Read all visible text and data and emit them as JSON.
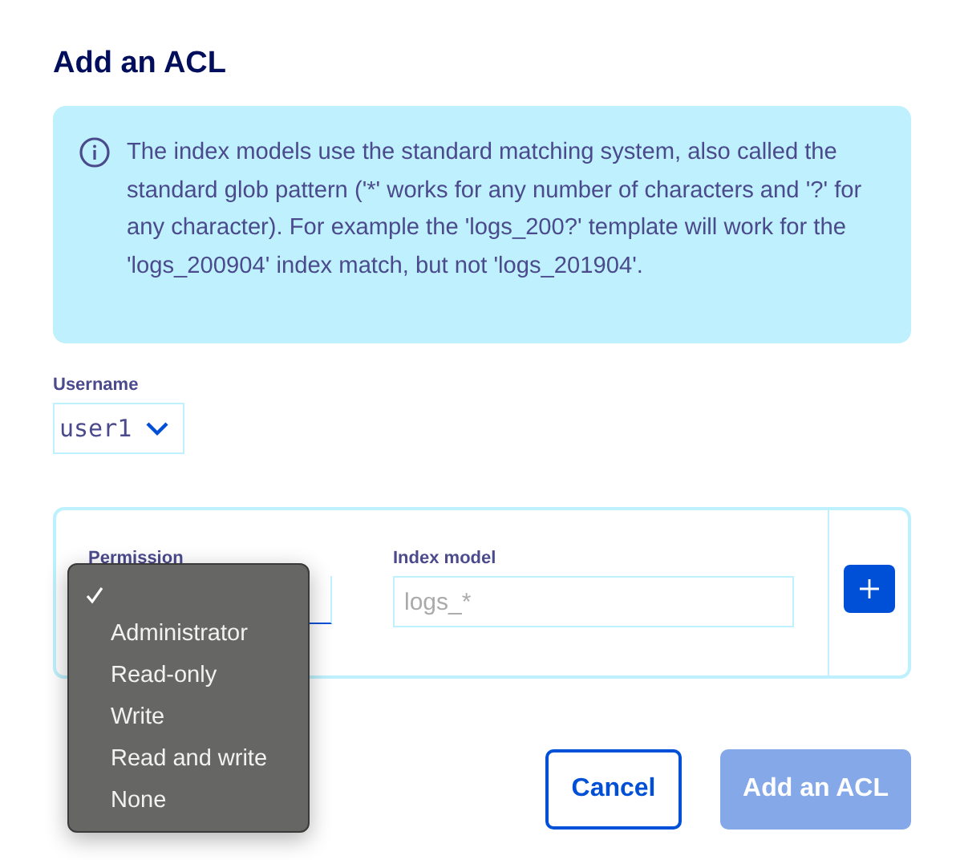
{
  "title": "Add an ACL",
  "info": "The index models use the standard matching system, also called the standard glob pattern ('*' works for any number of characters and '?' for any character). For example the 'logs_200?' template will work for the 'logs_200904' index match, but not 'logs_201904'.",
  "username": {
    "label": "Username",
    "value": "user1"
  },
  "permission": {
    "label": "Permission",
    "options": [
      {
        "selected": true
      },
      {
        "label": "Administrator",
        "selected": false
      },
      {
        "label": "Read-only",
        "selected": false
      },
      {
        "label": "Write",
        "selected": false
      },
      {
        "label": "Read and write",
        "selected": false
      },
      {
        "label": "None",
        "selected": false
      }
    ]
  },
  "index_model": {
    "label": "Index model",
    "placeholder": "logs_*"
  },
  "buttons": [
    {
      "label": "Cancel",
      "kind": "secondary",
      "disabled": false
    },
    {
      "label": "Add an ACL",
      "kind": "primary",
      "disabled": true
    }
  ]
}
